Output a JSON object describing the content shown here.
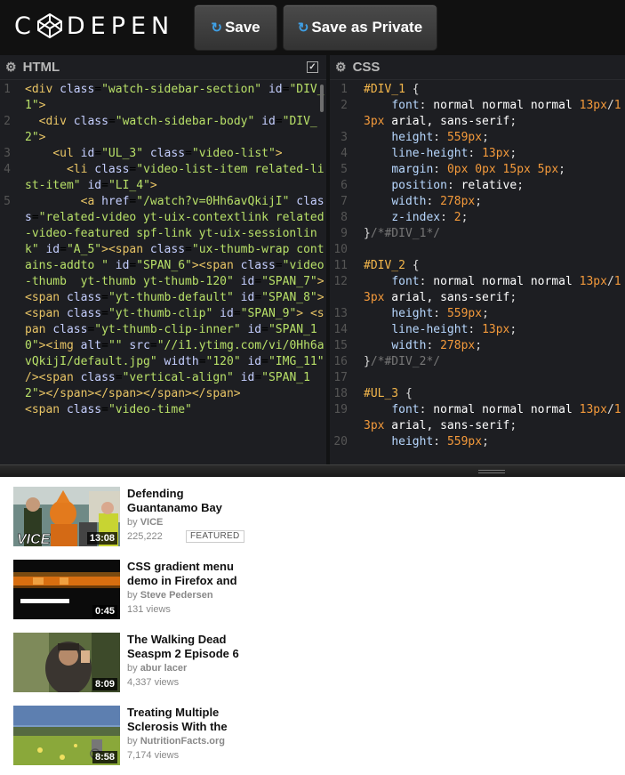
{
  "app": {
    "logo_text": "C DEPEN"
  },
  "toolbar": {
    "save_label": "Save",
    "save_private_label": "Save as Private",
    "save_icon": "refresh-icon"
  },
  "html_pane": {
    "title": "HTML",
    "settings_icon": "gear-icon",
    "collapse_icon": "checkbox-icon"
  },
  "css_pane": {
    "title": "CSS",
    "settings_icon": "gear-icon"
  },
  "html_code": [
    {
      "n": "1",
      "parts": [
        [
          "t-tag",
          "<div "
        ],
        [
          "t-attr2",
          "class"
        ],
        [
          "t-pun",
          "="
        ],
        [
          "t-str",
          "\"watch-sidebar-section\""
        ],
        [
          "t-pun",
          " "
        ],
        [
          "t-attr2",
          "id"
        ],
        [
          "t-pun",
          "="
        ],
        [
          "t-str",
          "\"DIV_1\""
        ],
        [
          "t-tag",
          ">"
        ]
      ]
    },
    {
      "n": "2",
      "parts": [
        [
          "t-tag",
          "  <div "
        ],
        [
          "t-attr2",
          "class"
        ],
        [
          "t-pun",
          "="
        ],
        [
          "t-str",
          "\"watch-sidebar-body\""
        ],
        [
          "t-pun",
          " "
        ],
        [
          "t-attr2",
          "id"
        ],
        [
          "t-pun",
          "="
        ],
        [
          "t-str",
          "\"DIV_2\""
        ],
        [
          "t-tag",
          ">"
        ]
      ]
    },
    {
      "n": "3",
      "parts": [
        [
          "t-tag",
          "    <ul "
        ],
        [
          "t-attr2",
          "id"
        ],
        [
          "t-pun",
          "="
        ],
        [
          "t-str",
          "\"UL_3\""
        ],
        [
          "t-pun",
          " "
        ],
        [
          "t-attr2",
          "class"
        ],
        [
          "t-pun",
          "="
        ],
        [
          "t-str",
          "\"video-list\""
        ],
        [
          "t-tag",
          ">"
        ]
      ]
    },
    {
      "n": "4",
      "parts": [
        [
          "t-tag",
          "      <li "
        ],
        [
          "t-attr2",
          "class"
        ],
        [
          "t-pun",
          "="
        ],
        [
          "t-str",
          "\"video-list-item related-list-item\""
        ],
        [
          "t-pun",
          " "
        ],
        [
          "t-attr2",
          "id"
        ],
        [
          "t-pun",
          "="
        ],
        [
          "t-str",
          "\"LI_4\""
        ],
        [
          "t-tag",
          ">"
        ]
      ]
    },
    {
      "n": "5",
      "parts": [
        [
          "t-tag",
          "        <a "
        ],
        [
          "t-attr2",
          "href"
        ],
        [
          "t-pun",
          "="
        ],
        [
          "t-str",
          "\"/watch?v=0Hh6avQkijI\""
        ],
        [
          "t-pun",
          " "
        ],
        [
          "t-attr2",
          "class"
        ],
        [
          "t-pun",
          "="
        ],
        [
          "t-str",
          "\"related-video yt-uix-contextlink related-video-featured spf-link yt-uix-sessionlink\""
        ],
        [
          "t-pun",
          " "
        ],
        [
          "t-attr2",
          "id"
        ],
        [
          "t-pun",
          "="
        ],
        [
          "t-str",
          "\"A_5\""
        ],
        [
          "t-tag",
          ">"
        ],
        [
          "t-tag",
          "<span "
        ],
        [
          "t-attr2",
          "class"
        ],
        [
          "t-pun",
          "="
        ],
        [
          "t-str",
          "\"ux-thumb-wrap contains-addto \""
        ],
        [
          "t-pun",
          " "
        ],
        [
          "t-attr2",
          "id"
        ],
        [
          "t-pun",
          "="
        ],
        [
          "t-str",
          "\"SPAN_6\""
        ],
        [
          "t-tag",
          ">"
        ],
        [
          "t-tag",
          "<span "
        ],
        [
          "t-attr2",
          "class"
        ],
        [
          "t-pun",
          "="
        ],
        [
          "t-str",
          "\"video-thumb  yt-thumb yt-thumb-120\""
        ],
        [
          "t-pun",
          " "
        ],
        [
          "t-attr2",
          "id"
        ],
        [
          "t-pun",
          "="
        ],
        [
          "t-str",
          "\"SPAN_7\""
        ],
        [
          "t-tag",
          "> "
        ],
        [
          "t-tag",
          "<span "
        ],
        [
          "t-attr2",
          "class"
        ],
        [
          "t-pun",
          "="
        ],
        [
          "t-str",
          "\"yt-thumb-default\""
        ],
        [
          "t-pun",
          " "
        ],
        [
          "t-attr2",
          "id"
        ],
        [
          "t-pun",
          "="
        ],
        [
          "t-str",
          "\"SPAN_8\""
        ],
        [
          "t-tag",
          "> "
        ],
        [
          "t-tag",
          "<span "
        ],
        [
          "t-attr2",
          "class"
        ],
        [
          "t-pun",
          "="
        ],
        [
          "t-str",
          "\"yt-thumb-clip\""
        ],
        [
          "t-pun",
          " "
        ],
        [
          "t-attr2",
          "id"
        ],
        [
          "t-pun",
          "="
        ],
        [
          "t-str",
          "\"SPAN_9\""
        ],
        [
          "t-tag",
          "> "
        ],
        [
          "t-tag",
          "<span "
        ],
        [
          "t-attr2",
          "class"
        ],
        [
          "t-pun",
          "="
        ],
        [
          "t-str",
          "\"yt-thumb-clip-inner\""
        ],
        [
          "t-pun",
          " "
        ],
        [
          "t-attr2",
          "id"
        ],
        [
          "t-pun",
          "="
        ],
        [
          "t-str",
          "\"SPAN_10\""
        ],
        [
          "t-tag",
          ">"
        ],
        [
          "t-tag",
          "<img "
        ],
        [
          "t-attr2",
          "alt"
        ],
        [
          "t-pun",
          "="
        ],
        [
          "t-str",
          "\"\""
        ],
        [
          "t-pun",
          " "
        ],
        [
          "t-attr2",
          "src"
        ],
        [
          "t-pun",
          "="
        ],
        [
          "t-str",
          "\"//i1.ytimg.com/vi/0Hh6avQkijI/default.jpg\""
        ],
        [
          "t-pun",
          " "
        ],
        [
          "t-attr2",
          "width"
        ],
        [
          "t-pun",
          "="
        ],
        [
          "t-str",
          "\"120\""
        ],
        [
          "t-pun",
          " "
        ],
        [
          "t-attr2",
          "id"
        ],
        [
          "t-pun",
          "="
        ],
        [
          "t-str",
          "\"IMG_11\""
        ],
        [
          "t-pun",
          " "
        ],
        [
          "t-tag",
          "/>"
        ],
        [
          "t-tag",
          "<span "
        ],
        [
          "t-attr2",
          "class"
        ],
        [
          "t-pun",
          "="
        ],
        [
          "t-str",
          "\"vertical-align\""
        ],
        [
          "t-pun",
          " "
        ],
        [
          "t-attr2",
          "id"
        ],
        [
          "t-pun",
          "="
        ],
        [
          "t-str",
          "\"SPAN_12\""
        ],
        [
          "t-tag",
          ">"
        ],
        [
          "t-tag",
          "</span></span></span></span>"
        ]
      ]
    },
    {
      "n": "",
      "parts": [
        [
          "t-tag",
          "<span "
        ],
        [
          "t-attr2",
          "class"
        ],
        [
          "t-pun",
          "="
        ],
        [
          "t-str",
          "\"video-time\""
        ]
      ]
    }
  ],
  "css_code": [
    {
      "n": "1",
      "parts": [
        [
          "sel",
          "#DIV_1"
        ],
        [
          "pun",
          " {"
        ]
      ]
    },
    {
      "n": "2",
      "parts": [
        [
          "prop",
          "    font"
        ],
        [
          "pun",
          ": "
        ],
        [
          "val",
          "normal normal normal "
        ],
        [
          "num",
          "13px"
        ],
        [
          "pun",
          "/"
        ],
        [
          "num",
          "13px"
        ],
        [
          "val",
          " arial, sans-serif"
        ],
        [
          "pun",
          ";"
        ]
      ]
    },
    {
      "n": "3",
      "parts": [
        [
          "prop",
          "    height"
        ],
        [
          "pun",
          ": "
        ],
        [
          "num",
          "559px"
        ],
        [
          "pun",
          ";"
        ]
      ]
    },
    {
      "n": "4",
      "parts": [
        [
          "prop",
          "    line-height"
        ],
        [
          "pun",
          ": "
        ],
        [
          "num",
          "13px"
        ],
        [
          "pun",
          ";"
        ]
      ]
    },
    {
      "n": "5",
      "parts": [
        [
          "prop",
          "    margin"
        ],
        [
          "pun",
          ": "
        ],
        [
          "num",
          "0px 0px 15px 5px"
        ],
        [
          "pun",
          ";"
        ]
      ]
    },
    {
      "n": "6",
      "parts": [
        [
          "prop",
          "    position"
        ],
        [
          "pun",
          ": "
        ],
        [
          "val",
          "relative"
        ],
        [
          "pun",
          ";"
        ]
      ]
    },
    {
      "n": "7",
      "parts": [
        [
          "prop",
          "    width"
        ],
        [
          "pun",
          ": "
        ],
        [
          "num",
          "278px"
        ],
        [
          "pun",
          ";"
        ]
      ]
    },
    {
      "n": "8",
      "parts": [
        [
          "prop",
          "    z-index"
        ],
        [
          "pun",
          ": "
        ],
        [
          "num",
          "2"
        ],
        [
          "pun",
          ";"
        ]
      ]
    },
    {
      "n": "9",
      "parts": [
        [
          "pun",
          "}"
        ],
        [
          "cmt",
          "/*#DIV_1*/"
        ]
      ]
    },
    {
      "n": "10",
      "parts": []
    },
    {
      "n": "11",
      "parts": [
        [
          "sel",
          "#DIV_2"
        ],
        [
          "pun",
          " {"
        ]
      ]
    },
    {
      "n": "12",
      "parts": [
        [
          "prop",
          "    font"
        ],
        [
          "pun",
          ": "
        ],
        [
          "val",
          "normal normal normal "
        ],
        [
          "num",
          "13px"
        ],
        [
          "pun",
          "/"
        ],
        [
          "num",
          "13px"
        ],
        [
          "val",
          " arial, sans-serif"
        ],
        [
          "pun",
          ";"
        ]
      ]
    },
    {
      "n": "13",
      "parts": [
        [
          "prop",
          "    height"
        ],
        [
          "pun",
          ": "
        ],
        [
          "num",
          "559px"
        ],
        [
          "pun",
          ";"
        ]
      ]
    },
    {
      "n": "14",
      "parts": [
        [
          "prop",
          "    line-height"
        ],
        [
          "pun",
          ": "
        ],
        [
          "num",
          "13px"
        ],
        [
          "pun",
          ";"
        ]
      ]
    },
    {
      "n": "15",
      "parts": [
        [
          "prop",
          "    width"
        ],
        [
          "pun",
          ": "
        ],
        [
          "num",
          "278px"
        ],
        [
          "pun",
          ";"
        ]
      ]
    },
    {
      "n": "16",
      "parts": [
        [
          "pun",
          "}"
        ],
        [
          "cmt",
          "/*#DIV_2*/"
        ]
      ]
    },
    {
      "n": "17",
      "parts": []
    },
    {
      "n": "18",
      "parts": [
        [
          "sel",
          "#UL_3"
        ],
        [
          "pun",
          " {"
        ]
      ]
    },
    {
      "n": "19",
      "parts": [
        [
          "prop",
          "    font"
        ],
        [
          "pun",
          ": "
        ],
        [
          "val",
          "normal normal normal "
        ],
        [
          "num",
          "13px"
        ],
        [
          "pun",
          "/"
        ],
        [
          "num",
          "13px"
        ],
        [
          "val",
          " arial, sans-serif"
        ],
        [
          "pun",
          ";"
        ]
      ]
    },
    {
      "n": "20",
      "parts": [
        [
          "prop",
          "    height"
        ],
        [
          "pun",
          ": "
        ],
        [
          "num",
          "559px"
        ],
        [
          "pun",
          ";"
        ]
      ]
    }
  ],
  "results": {
    "videos": [
      {
        "title": "Defending Guantanamo Bay",
        "by_prefix": "by ",
        "author": "VICE",
        "views": "225,222",
        "badge": "FEATURED",
        "duration": "13:08",
        "thumb": "vice"
      },
      {
        "title": "CSS gradient menu demo in Firefox and",
        "by_prefix": "by ",
        "author": "Steve Pedersen",
        "views": "131 views",
        "badge": "",
        "duration": "0:45",
        "thumb": "css"
      },
      {
        "title": "The Walking Dead Seaspm 2 Episode 6",
        "by_prefix": "by ",
        "author": "abur lacer",
        "views": "4,337 views",
        "badge": "",
        "duration": "8:09",
        "thumb": "twd"
      },
      {
        "title": "Treating Multiple Sclerosis With the",
        "by_prefix": "by ",
        "author": "NutritionFacts.org",
        "views": "7,174 views",
        "badge": "",
        "duration": "8:58",
        "thumb": "field"
      }
    ]
  }
}
